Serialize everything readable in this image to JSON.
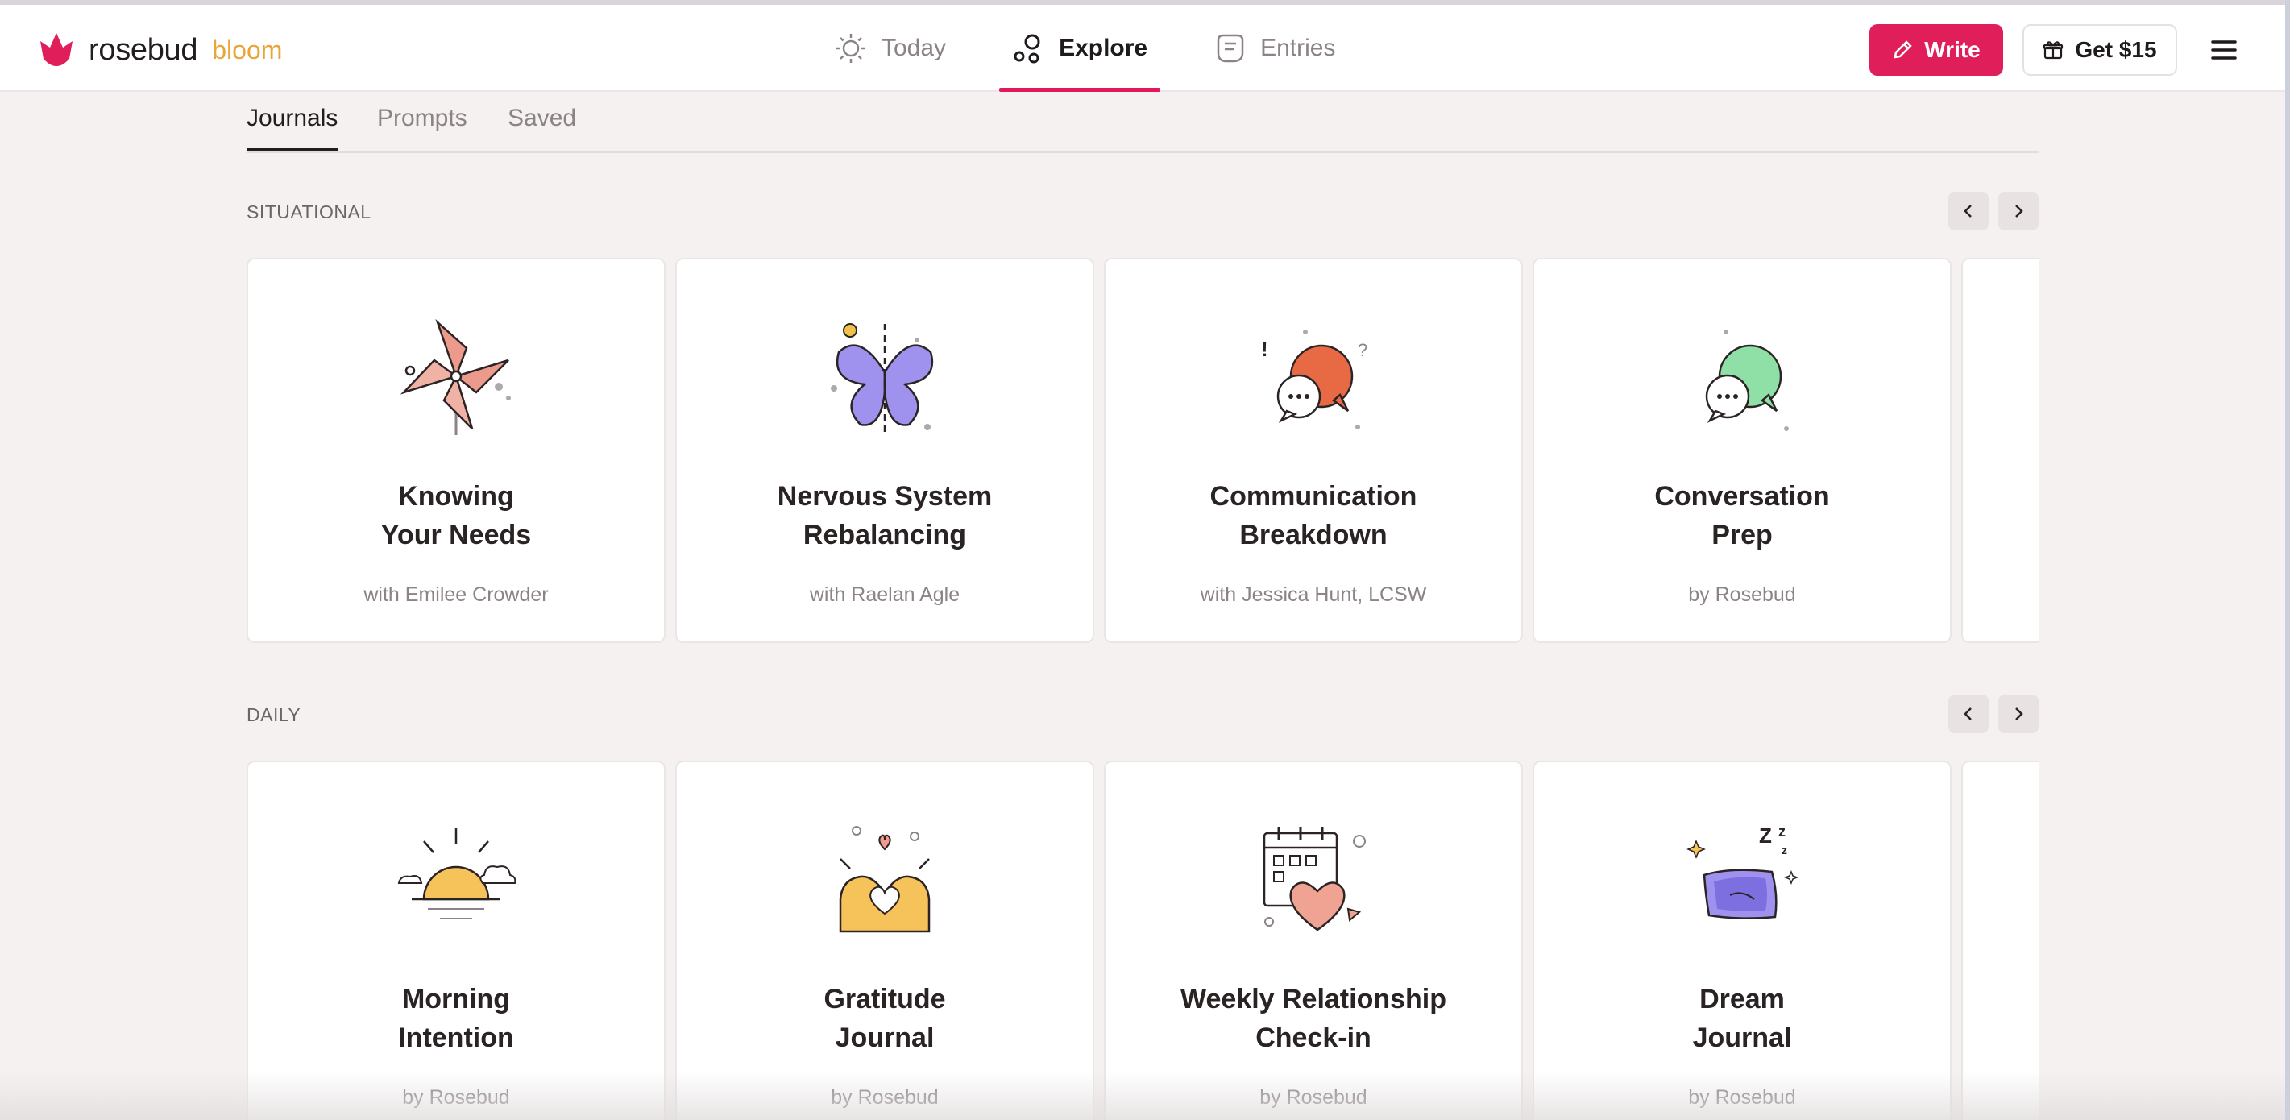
{
  "brand": {
    "name": "rosebud",
    "sub": "bloom",
    "accent": "#e01e5a",
    "sub_color": "#e9a53a"
  },
  "nav": [
    {
      "label": "Today",
      "icon": "sun-icon",
      "active": false
    },
    {
      "label": "Explore",
      "icon": "explore-icon",
      "active": true
    },
    {
      "label": "Entries",
      "icon": "entries-icon",
      "active": false
    }
  ],
  "actions": {
    "write_label": "Write",
    "get_label": "Get $15"
  },
  "subtabs": [
    {
      "label": "Journals",
      "active": true
    },
    {
      "label": "Prompts",
      "active": false
    },
    {
      "label": "Saved",
      "active": false
    }
  ],
  "sections": [
    {
      "label": "SITUATIONAL",
      "cards": [
        {
          "title": [
            "Knowing",
            "Your Needs"
          ],
          "subtitle": "with Emilee Crowder",
          "icon": "pinwheel-icon"
        },
        {
          "title": [
            "Nervous System",
            "Rebalancing"
          ],
          "subtitle": "with Raelan Agle",
          "icon": "butterfly-icon"
        },
        {
          "title": [
            "Communication",
            "Breakdown"
          ],
          "subtitle": "with Jessica Hunt, LCSW",
          "icon": "speech-bubbles-orange-icon"
        },
        {
          "title": [
            "Conversation",
            "Prep"
          ],
          "subtitle": "by Rosebud",
          "icon": "speech-bubbles-green-icon"
        }
      ]
    },
    {
      "label": "DAILY",
      "cards": [
        {
          "title": [
            "Morning",
            "Intention"
          ],
          "subtitle": "by Rosebud",
          "icon": "sunrise-icon"
        },
        {
          "title": [
            "Gratitude",
            "Journal"
          ],
          "subtitle": "by Rosebud",
          "icon": "heart-hands-icon"
        },
        {
          "title": [
            "Weekly Relationship",
            "Check-in"
          ],
          "subtitle": "by Rosebud",
          "icon": "calendar-heart-icon"
        },
        {
          "title": [
            "Dream",
            "Journal"
          ],
          "subtitle": "by Rosebud",
          "icon": "pillow-icon"
        }
      ]
    }
  ]
}
